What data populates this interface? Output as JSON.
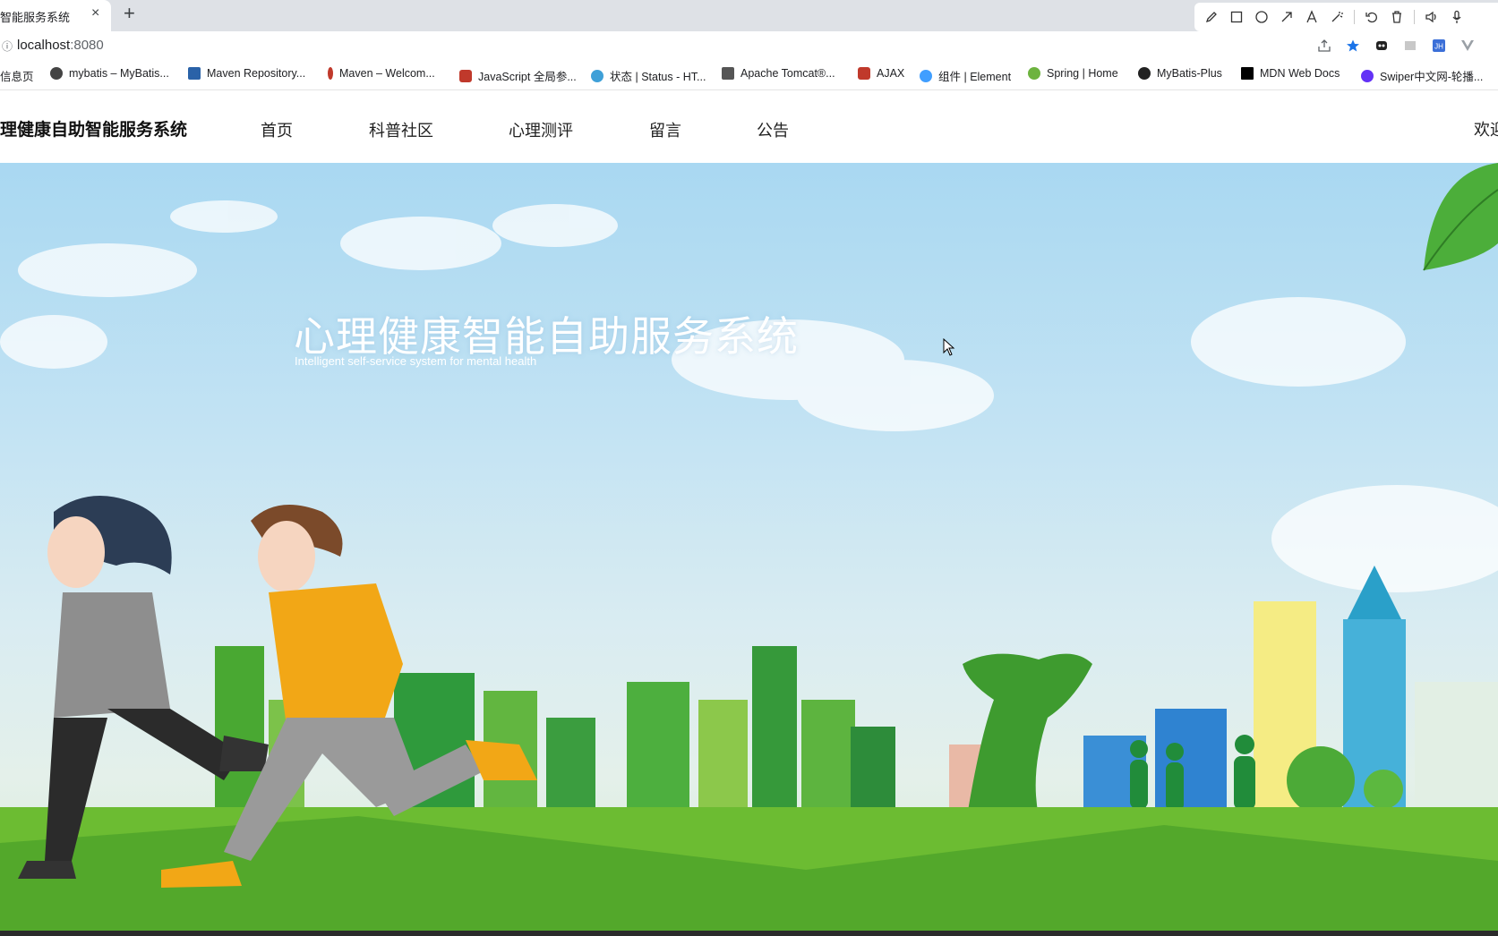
{
  "browser": {
    "tab_title": "智能服务系统",
    "tab_close": "×",
    "new_tab": "+",
    "address_info": "ⓘ",
    "url_host": "localhost",
    "url_port": ":8080",
    "draw_tools": [
      "pencil-icon",
      "rectangle-icon",
      "circle-icon",
      "arrow-icon",
      "text-icon",
      "magic-wand-icon",
      "undo-icon",
      "trash-icon",
      "speaker-icon",
      "microphone-icon"
    ],
    "address_icons": [
      "share-icon",
      "star-icon",
      "extension-icon",
      "reader-icon",
      "jh-extension-icon",
      "vue-devtools-icon",
      "more-icon"
    ],
    "bookmarks": [
      {
        "label": "信息页",
        "color": "#e8e8e8"
      },
      {
        "label": "mybatis – MyBatis...",
        "color": "#333333"
      },
      {
        "label": "Maven Repository...",
        "color": "#2a62a8"
      },
      {
        "label": "Maven – Welcom...",
        "color": "#c0392b"
      },
      {
        "label": "JavaScript 全局参...",
        "color": "#c0392b"
      },
      {
        "label": "状态 | Status - HT...",
        "color": "#3fa0d8"
      },
      {
        "label": "Apache Tomcat®...",
        "color": "#555555"
      },
      {
        "label": "AJAX",
        "color": "#c0392b"
      },
      {
        "label": "组件 | Element",
        "color": "#409eff"
      },
      {
        "label": "Spring | Home",
        "color": "#6db33f"
      },
      {
        "label": "MyBatis-Plus",
        "color": "#222222"
      },
      {
        "label": "MDN Web Docs",
        "color": "#000000"
      },
      {
        "label": "Swiper中文网-轮播...",
        "color": "#6332f6"
      }
    ]
  },
  "site": {
    "brand": "理健康自助智能服务系统",
    "nav": [
      "首页",
      "科普社区",
      "心理测评",
      "留言",
      "公告"
    ],
    "welcome": "欢迎"
  },
  "hero": {
    "title": "心理健康智能自助服务系统",
    "subtitle": "Intelligent self-service system for mental health"
  }
}
